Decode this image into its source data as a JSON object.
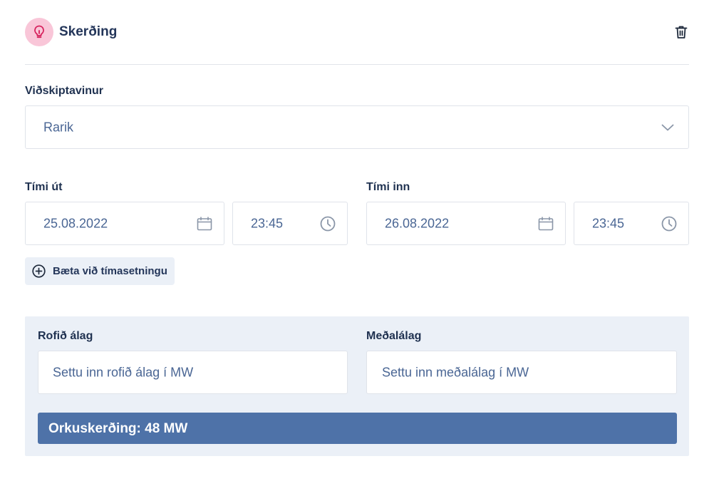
{
  "header": {
    "title": "Skerðing",
    "icon": "lightbulb-icon",
    "icon_bg": "#f9c6d8",
    "icon_color": "#d61f5b",
    "delete_icon": "trash-icon"
  },
  "customer": {
    "label": "Viðskiptavinur",
    "value": "Rarik",
    "icon": "chevron-down-icon"
  },
  "time_out": {
    "label": "Tími út",
    "date": "25.08.2022",
    "time": "23:45"
  },
  "time_in": {
    "label": "Tími inn",
    "date": "26.08.2022",
    "time": "23:45"
  },
  "add_time": {
    "label": "Bæta við tímasetningu",
    "icon": "plus-circle-icon"
  },
  "load": {
    "interrupted_label": "Rofið álag",
    "interrupted_placeholder": "Settu inn rofið álag í MW",
    "average_label": "Meðalálag",
    "average_placeholder": "Settu inn meðalálag í MW"
  },
  "result": {
    "text": "Orkuskerðing: 48 MW",
    "color": "#4e72a8"
  }
}
